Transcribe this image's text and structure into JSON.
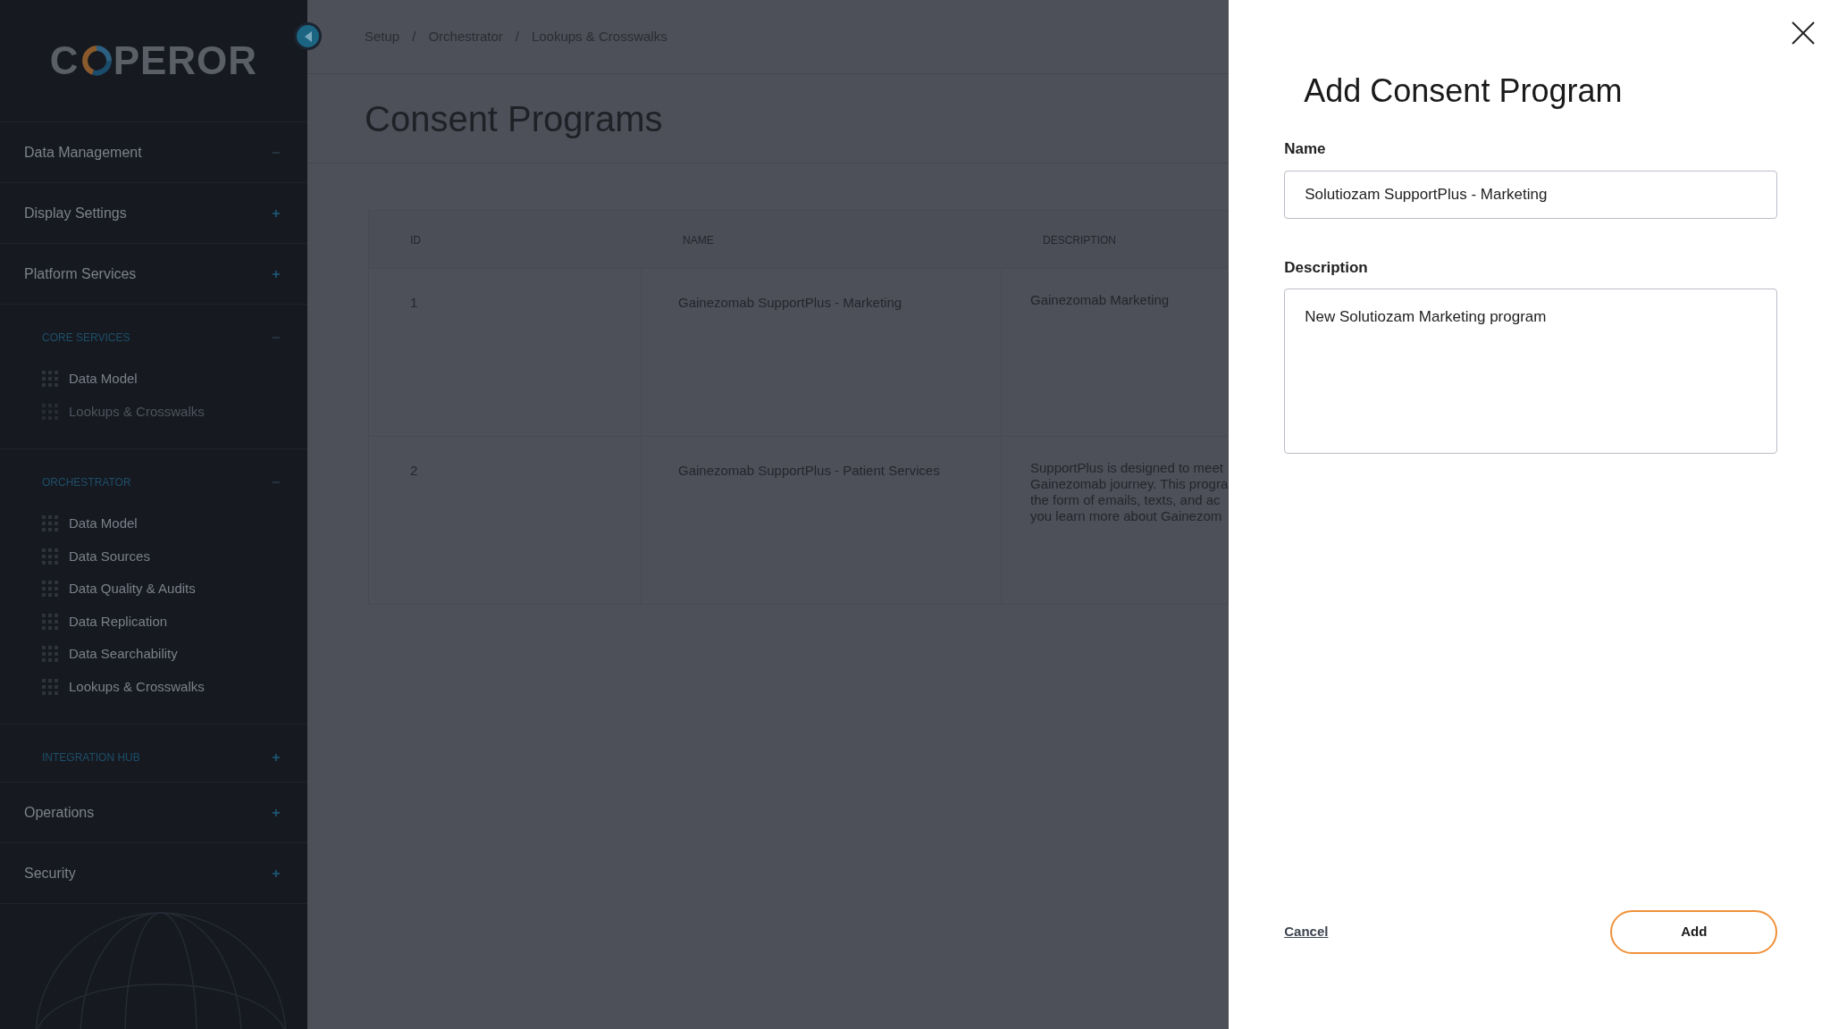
{
  "sidebar": {
    "logo": {
      "before": "C",
      "after": "PEROR"
    },
    "groups": [
      {
        "label": "Data Management",
        "kind": "section",
        "expanded": true
      },
      {
        "label": "Display Settings",
        "kind": "section",
        "expanded": false
      },
      {
        "label": "Platform Services",
        "kind": "section",
        "expanded": false
      },
      {
        "label": "CORE SERVICES",
        "kind": "subsection",
        "expanded": true,
        "children": [
          {
            "label": "Data Model",
            "disabled": false
          },
          {
            "label": "Lookups & Crosswalks",
            "disabled": true
          }
        ]
      },
      {
        "label": "ORCHESTRATOR",
        "kind": "subsection",
        "expanded": true,
        "children": [
          {
            "label": "Data Model",
            "disabled": false
          },
          {
            "label": "Data Sources",
            "disabled": false
          },
          {
            "label": "Data Quality & Audits",
            "disabled": false
          },
          {
            "label": "Data Replication",
            "disabled": false
          },
          {
            "label": "Data Searchability",
            "disabled": false
          },
          {
            "label": "Lookups & Crosswalks",
            "disabled": false
          }
        ]
      },
      {
        "label": "INTEGRATION HUB",
        "kind": "subsection",
        "expanded": false
      },
      {
        "label": "Operations",
        "kind": "section",
        "expanded": false
      },
      {
        "label": "Security",
        "kind": "section",
        "expanded": false
      }
    ]
  },
  "breadcrumb": [
    "Setup",
    "Orchestrator",
    "Lookups & Crosswalks"
  ],
  "breadcrumb_separator": "/",
  "page_title": "Consent Programs",
  "table": {
    "columns": [
      "ID",
      "NAME",
      "DESCRIPTION"
    ],
    "rows": [
      {
        "id": "1",
        "name": "Gainezomab SupportPlus - Marketing",
        "description": [
          "Gainezomab Marketing"
        ]
      },
      {
        "id": "2",
        "name": "Gainezomab SupportPlus - Patient Services",
        "description": [
          "SupportPlus is designed to meet",
          "Gainezomab journey. This progra",
          "the form of emails, texts, and ac",
          "you learn more about Gainezom"
        ]
      }
    ]
  },
  "drawer": {
    "title": "Add Consent Program",
    "fields": [
      {
        "label": "Name",
        "kind": "input",
        "value": "Solutiozam SupportPlus - Marketing"
      },
      {
        "label": "Description",
        "kind": "textarea",
        "value": "New Solutiozam Marketing program"
      }
    ],
    "cancel": "Cancel",
    "submit": "Add"
  }
}
